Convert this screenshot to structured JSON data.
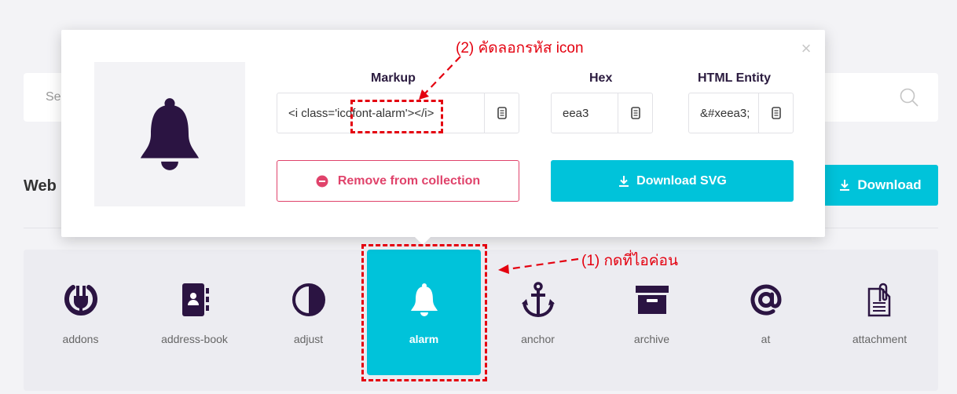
{
  "search": {
    "placeholder_visible": "Se"
  },
  "section": {
    "title_visible": "Web"
  },
  "bg_download_label": "Download",
  "modal": {
    "markup_header": "Markup",
    "hex_header": "Hex",
    "entity_header": "HTML Entity",
    "markup_value": "<i class='icofont-alarm'></i>",
    "hex_value": "eea3",
    "entity_value": "&#xeea3;",
    "remove_label": "Remove from collection",
    "download_svg_label": "Download SVG",
    "close_symbol": "×"
  },
  "icons": [
    {
      "label": "addons",
      "icon": "plug-icon"
    },
    {
      "label": "address-book",
      "icon": "address-book-icon"
    },
    {
      "label": "adjust",
      "icon": "adjust-icon"
    },
    {
      "label": "alarm",
      "icon": "bell-icon",
      "active": true
    },
    {
      "label": "anchor",
      "icon": "anchor-icon"
    },
    {
      "label": "archive",
      "icon": "archive-icon"
    },
    {
      "label": "at",
      "icon": "at-icon"
    },
    {
      "label": "attachment",
      "icon": "attachment-icon"
    }
  ],
  "annotations": {
    "step1": "(1) กดที่ไอค่อน",
    "step2": "(2) คัดลอกรหัส icon"
  },
  "colors": {
    "accent": "#00c3da",
    "danger": "#e0436b",
    "icon_dark": "#2b1442",
    "annotation": "#e4000f"
  }
}
